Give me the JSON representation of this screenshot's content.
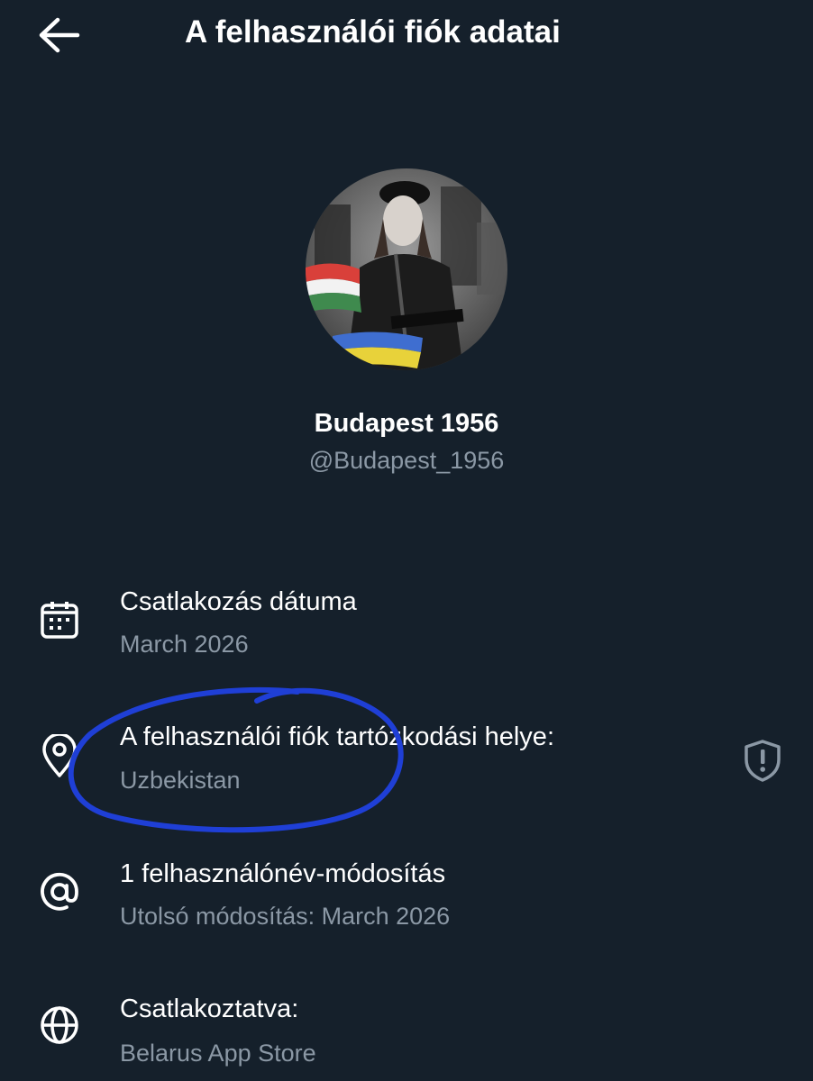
{
  "header": {
    "title": "A felhasználói fiók adatai",
    "back_icon": "arrow-left-icon"
  },
  "profile": {
    "display_name": "Budapest 1956",
    "handle": "@Budapest_1956"
  },
  "info": {
    "joined": {
      "icon": "calendar-icon",
      "label": "Csatlakozás dátuma",
      "value": "March 2026"
    },
    "location": {
      "icon": "location-pin-icon",
      "label": "A felhasználói fiók tartózkodási helye:",
      "value": "Uzbekistan",
      "shield_icon": "shield-exclamation-icon"
    },
    "username_changes": {
      "icon": "at-sign-icon",
      "label": "1 felhasználónév-módosítás",
      "value": "Utolsó módosítás: March 2026"
    },
    "connected_via": {
      "icon": "globe-icon",
      "label": "Csatlakoztatva:",
      "value": "Belarus App Store"
    }
  },
  "colors": {
    "background": "#15202b",
    "primary_text": "#ffffff",
    "secondary_text": "#8b98a5",
    "annotation_ink": "#1f3fd6"
  }
}
